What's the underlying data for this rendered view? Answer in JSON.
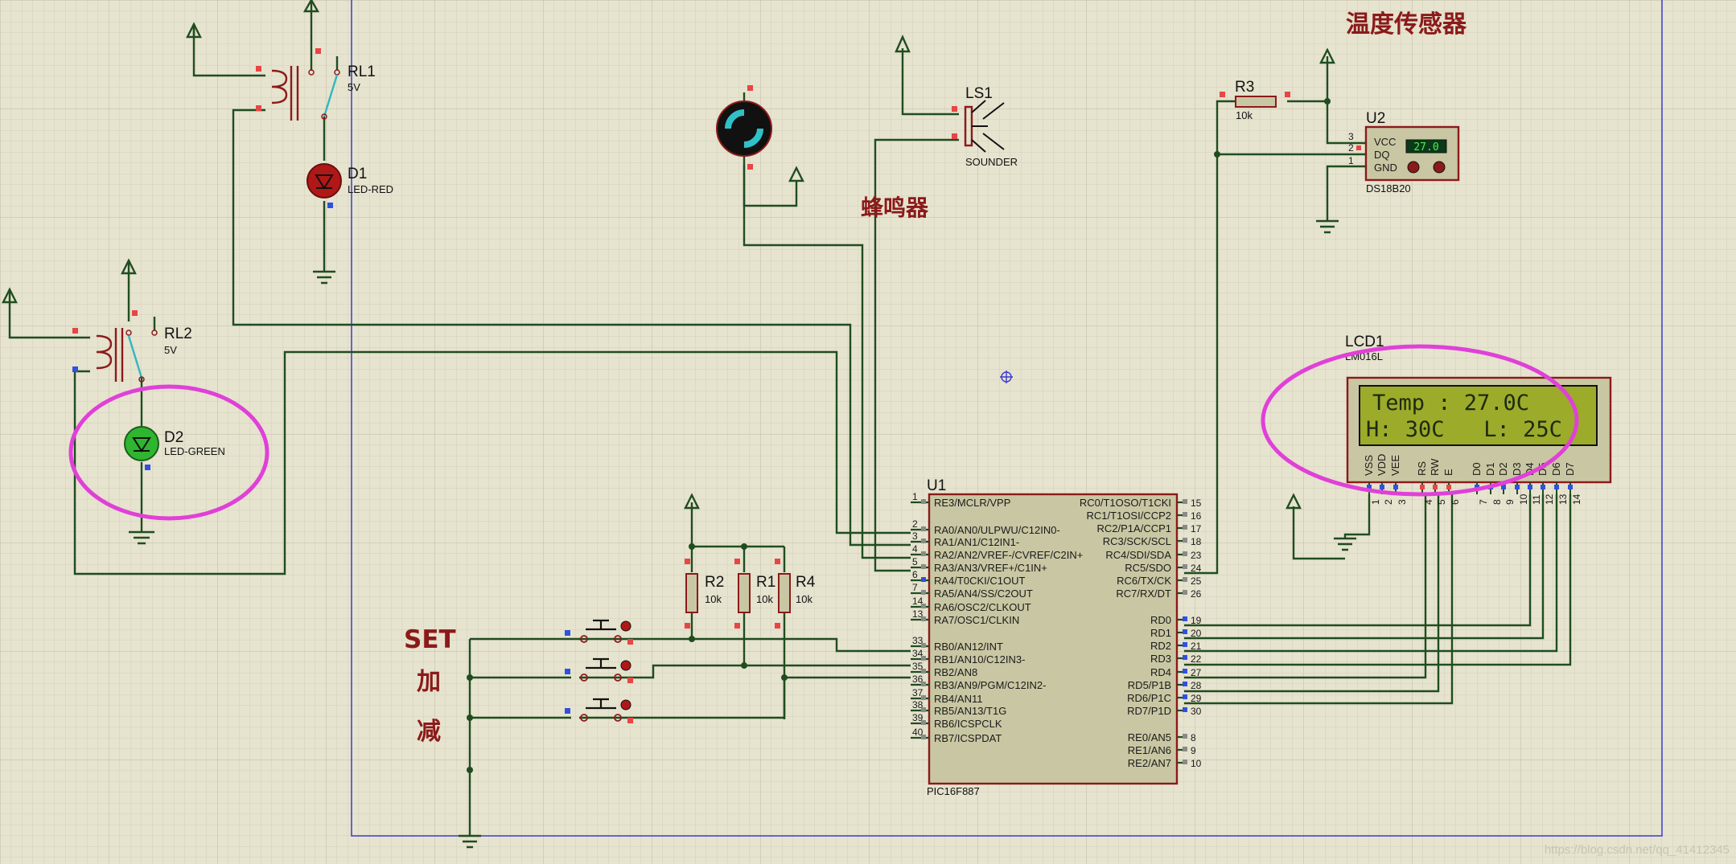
{
  "colors": {
    "background": "#e6e3cf",
    "grid_minor": "#d2cfbb",
    "grid_major": "#c5c2ad",
    "wire": "#1f4d1f",
    "component_body": "#c9c7a3",
    "component_border": "#8b1a1a",
    "annotation_ellipse": "#e040d8",
    "pin_red": "#e84545",
    "pin_blue": "#3050e0",
    "sheet_border": "#3a3ad0",
    "lcd_screen": "#9cab2a",
    "chinese_label": "#8b1a1a"
  },
  "labels": {
    "temp_sensor_cn": "温度传感器",
    "buzzer_cn": "蜂鸣器",
    "set": "SET",
    "plus_cn": "加",
    "minus_cn": "减"
  },
  "components": {
    "rl1": {
      "ref": "RL1",
      "value": "5V"
    },
    "rl2": {
      "ref": "RL2",
      "value": "5V"
    },
    "d1": {
      "ref": "D1",
      "value": "LED-RED"
    },
    "d2": {
      "ref": "D2",
      "value": "LED-GREEN"
    },
    "ls1": {
      "ref": "LS1",
      "value": "SOUNDER"
    },
    "r3": {
      "ref": "R3",
      "value": "10k"
    },
    "r2": {
      "ref": "R2",
      "value": "10k"
    },
    "r1": {
      "ref": "R1",
      "value": "10k"
    },
    "r4": {
      "ref": "R4",
      "value": "10k"
    },
    "u2": {
      "ref": "U2",
      "part": "DS18B20",
      "pins": [
        "VCC",
        "DQ",
        "GND"
      ],
      "pin_numbers": [
        "3",
        "2",
        "1"
      ],
      "display": "27.0"
    },
    "lcd1": {
      "ref": "LCD1",
      "part": "LM016L",
      "line1": "Temp : 27.0C",
      "line2": "H: 30C   L: 25C",
      "pins": [
        "VSS",
        "VDD",
        "VEE",
        "RS",
        "RW",
        "E",
        "D0",
        "D1",
        "D2",
        "D3",
        "D4",
        "D5",
        "D6",
        "D7"
      ],
      "pin_numbers": [
        "1",
        "2",
        "3",
        "4",
        "5",
        "6",
        "7",
        "8",
        "9",
        "10",
        "11",
        "12",
        "13",
        "14"
      ]
    },
    "u1": {
      "ref": "U1",
      "part": "PIC16F887",
      "left_pins": [
        {
          "num": "1",
          "name": "RE3/MCLR/VPP"
        },
        {
          "num": "2",
          "name": "RA0/AN0/ULPWU/C12IN0-"
        },
        {
          "num": "3",
          "name": "RA1/AN1/C12IN1-"
        },
        {
          "num": "4",
          "name": "RA2/AN2/VREF-/CVREF/C2IN+"
        },
        {
          "num": "5",
          "name": "RA3/AN3/VREF+/C1IN+"
        },
        {
          "num": "6",
          "name": "RA4/T0CKI/C1OUT"
        },
        {
          "num": "7",
          "name": "RA5/AN4/SS/C2OUT"
        },
        {
          "num": "14",
          "name": "RA6/OSC2/CLKOUT"
        },
        {
          "num": "13",
          "name": "RA7/OSC1/CLKIN"
        },
        {
          "num": "33",
          "name": "RB0/AN12/INT"
        },
        {
          "num": "34",
          "name": "RB1/AN10/C12IN3-"
        },
        {
          "num": "35",
          "name": "RB2/AN8"
        },
        {
          "num": "36",
          "name": "RB3/AN9/PGM/C12IN2-"
        },
        {
          "num": "37",
          "name": "RB4/AN11"
        },
        {
          "num": "38",
          "name": "RB5/AN13/T1G"
        },
        {
          "num": "39",
          "name": "RB6/ICSPCLK"
        },
        {
          "num": "40",
          "name": "RB7/ICSPDAT"
        }
      ],
      "right_pins": [
        {
          "num": "15",
          "name": "RC0/T1OSO/T1CKI"
        },
        {
          "num": "16",
          "name": "RC1/T1OSI/CCP2"
        },
        {
          "num": "17",
          "name": "RC2/P1A/CCP1"
        },
        {
          "num": "18",
          "name": "RC3/SCK/SCL"
        },
        {
          "num": "23",
          "name": "RC4/SDI/SDA"
        },
        {
          "num": "24",
          "name": "RC5/SDO"
        },
        {
          "num": "25",
          "name": "RC6/TX/CK"
        },
        {
          "num": "26",
          "name": "RC7/RX/DT"
        },
        {
          "num": "19",
          "name": "RD0"
        },
        {
          "num": "20",
          "name": "RD1"
        },
        {
          "num": "21",
          "name": "RD2"
        },
        {
          "num": "22",
          "name": "RD3"
        },
        {
          "num": "27",
          "name": "RD4"
        },
        {
          "num": "28",
          "name": "RD5/P1B"
        },
        {
          "num": "29",
          "name": "RD6/P1C"
        },
        {
          "num": "30",
          "name": "RD7/P1D"
        },
        {
          "num": "8",
          "name": "RE0/AN5"
        },
        {
          "num": "9",
          "name": "RE1/AN6"
        },
        {
          "num": "10",
          "name": "RE2/AN7"
        }
      ]
    }
  },
  "watermark": "https://blog.csdn.net/qq_41412345"
}
